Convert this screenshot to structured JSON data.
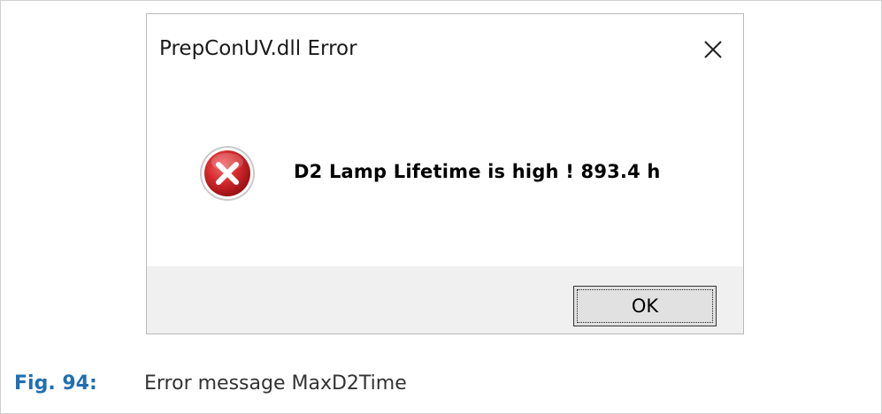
{
  "dialog": {
    "title": "PrepConUV.dll Error",
    "message": "D2 Lamp Lifetime is high ! 893.4 h",
    "ok_label": "OK",
    "icon": "error-icon",
    "close_icon": "close-icon"
  },
  "caption": {
    "label": "Fig. 94:",
    "text": "Error message MaxD2Time"
  },
  "colors": {
    "caption_label": "#1f6fb2",
    "error_red": "#d3282c",
    "footer_bg": "#f0f0f0"
  }
}
